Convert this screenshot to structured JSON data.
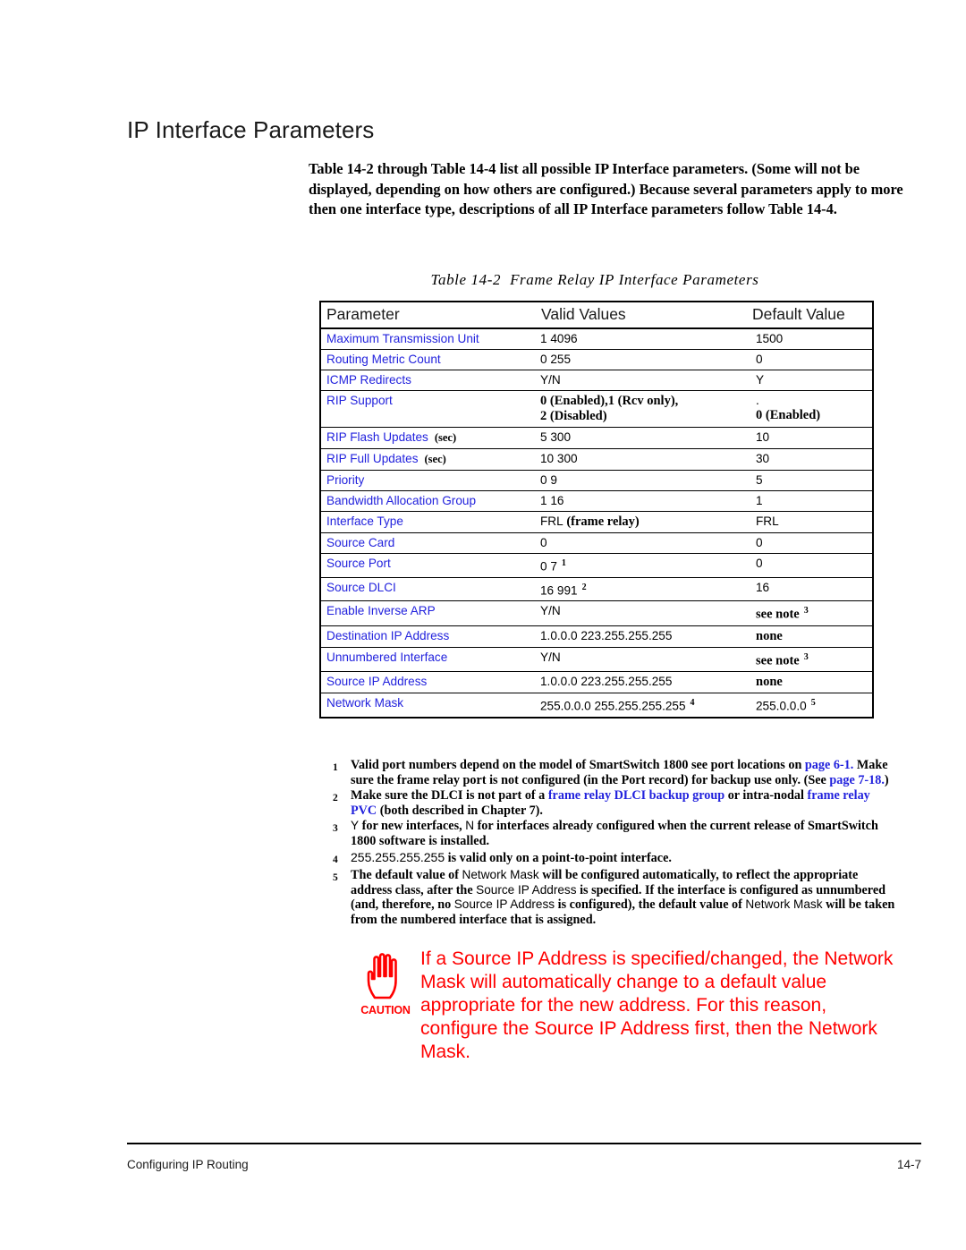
{
  "heading": "IP Interface Parameters",
  "intro": "Table 14-2 through Table 14-4 list all possible IP Interface parameters. (Some will not be displayed, depending on how others are configured.) Because several parameters apply to more then one interface type, descriptions of all IP Interface parameters follow Table 14-4.",
  "table": {
    "caption_number": "Table 14-2",
    "caption_title": "Frame Relay IP Interface Parameters",
    "columns": [
      "Parameter",
      "Valid Values",
      "Default Value"
    ],
    "rows": [
      {
        "parameter": "Maximum Transmission Unit",
        "unit": "",
        "valid": "1 4096",
        "default": "1500"
      },
      {
        "parameter": "Routing Metric Count",
        "unit": "",
        "valid": "0 255",
        "default": "0"
      },
      {
        "parameter": "ICMP Redirects",
        "unit": "",
        "valid": "Y/N",
        "default": "Y"
      },
      {
        "parameter": "RIP Support",
        "unit": "",
        "valid": "0 (Enabled),1 (Rcv only),",
        "valid_line2": "2 (Disabled)",
        "default": "0 (Enabled)"
      },
      {
        "parameter": "RIP Flash Updates",
        "unit": "(sec)",
        "valid": "5 300",
        "default": "10"
      },
      {
        "parameter": "RIP Full Updates",
        "unit": "(sec)",
        "valid": "10 300",
        "default": "30"
      },
      {
        "parameter": "Priority",
        "unit": "",
        "valid": "0 9",
        "default": "5"
      },
      {
        "parameter": "Bandwidth Allocation Group",
        "unit": "",
        "valid": "1 16",
        "default": "1"
      },
      {
        "parameter": "Interface Type",
        "unit": "",
        "valid": "FRL",
        "valid_bold": "(frame relay)",
        "default": "FRL"
      },
      {
        "parameter": "Source Card",
        "unit": "",
        "valid": "0",
        "default": "0"
      },
      {
        "parameter": "Source Port",
        "unit": "",
        "valid": "0 7",
        "valid_note": "1",
        "default": "0"
      },
      {
        "parameter": "Source DLCI",
        "unit": "",
        "valid": "16 991",
        "valid_note": "2",
        "default": "16"
      },
      {
        "parameter": "Enable Inverse ARP",
        "unit": "",
        "valid": "Y/N",
        "default": "see note",
        "default_note": "3"
      },
      {
        "parameter": "Destination IP Address",
        "unit": "",
        "valid": "1.0.0.0 223.255.255.255",
        "default": "none"
      },
      {
        "parameter": "Unnumbered Interface",
        "unit": "",
        "valid": "Y/N",
        "default": "see note",
        "default_note": "3"
      },
      {
        "parameter": "Source IP Address",
        "unit": "",
        "valid": "1.0.0.0 223.255.255.255",
        "default": "none"
      },
      {
        "parameter": "Network Mask",
        "unit": "",
        "valid": "255.0.0.0 255.255.255.255",
        "valid_note": "4",
        "default": "255.0.0.0",
        "default_note": "5"
      }
    ]
  },
  "footnotes": [
    {
      "num": "1",
      "parts": [
        {
          "t": "Valid port numbers depend on the model of SmartSwitch 1800 see port locations on ",
          "s": "plain"
        },
        {
          "t": "page 6-1.",
          "s": "link"
        },
        {
          "t": " Make sure the frame relay port is not configured (in the Port record) for backup use only. (See ",
          "s": "plain"
        },
        {
          "t": "page 7-18.",
          "s": "link"
        },
        {
          "t": ")",
          "s": "plain"
        }
      ]
    },
    {
      "num": "2",
      "parts": [
        {
          "t": "Make sure the DLCI is not part of a ",
          "s": "plain"
        },
        {
          "t": "frame relay DLCI backup group",
          "s": "link"
        },
        {
          "t": " or intra-nodal ",
          "s": "plain"
        },
        {
          "t": "frame relay PVC",
          "s": "link"
        },
        {
          "t": " (both described in Chapter 7).",
          "s": "plain"
        }
      ]
    },
    {
      "num": "3",
      "parts": [
        {
          "t": "Y",
          "s": "sans"
        },
        {
          "t": " for new interfaces, ",
          "s": "plain"
        },
        {
          "t": "N",
          "s": "sans"
        },
        {
          "t": " for interfaces already configured when the current release of SmartSwitch 1800 software is installed.",
          "s": "plain"
        }
      ]
    },
    {
      "num": "4",
      "parts": [
        {
          "t": "255.255.255.255",
          "s": "sansnum"
        },
        {
          "t": " is valid only on a point-to-point interface.",
          "s": "plain"
        }
      ]
    },
    {
      "num": "5",
      "parts": [
        {
          "t": "The default value of ",
          "s": "plain"
        },
        {
          "t": "Network Mask",
          "s": "sans"
        },
        {
          "t": " will be configured automatically, to reflect the appropriate address class, after the ",
          "s": "plain"
        },
        {
          "t": "Source IP Address",
          "s": "sans"
        },
        {
          "t": " is specified. If the interface is configured as unnumbered (and, therefore, no ",
          "s": "plain"
        },
        {
          "t": "Source IP Address",
          "s": "sans"
        },
        {
          "t": " is configured), the default value of ",
          "s": "plain"
        },
        {
          "t": "Network Mask",
          "s": "sans"
        },
        {
          "t": " will be taken from the numbered interface that is assigned.",
          "s": "plain"
        }
      ]
    }
  ],
  "caution": {
    "label": "CAUTION",
    "text": "If a Source IP Address is specified/changed, the Network Mask will automatically change to a default value appropriate for the new address. For this reason, configure the Source IP Address first, then the Network Mask."
  },
  "footer": {
    "left": "Configuring IP Routing",
    "right": "14-7"
  },
  "colors": {
    "link_blue": "#2222dd",
    "caution_red": "#ff0000",
    "text_black": "#000000"
  }
}
